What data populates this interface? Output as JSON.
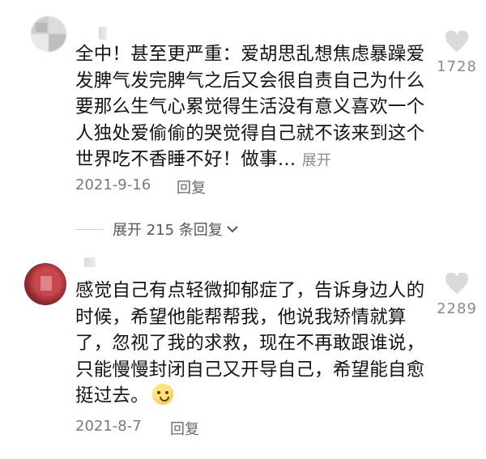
{
  "comments": [
    {
      "text": "全中！甚至更严重：爱胡思乱想焦虑暴躁爱发脾气发完脾气之后又会很自责自己为什么要那么生气心累觉得生活没有意义喜欢一个人独处爱偷偷的哭觉得自己就不该来到这个世界吃不香睡不好！做事…",
      "expand_label": "展开",
      "date": "2021-9-16",
      "reply_label": "回复",
      "like_count": "1728",
      "expand_replies_label": "展开 215 条回复"
    },
    {
      "text": "感觉自己有点轻微抑郁症了，告诉身边人的时候，希望他能帮帮我，他说我矫情就算了，忽视了我的求救，现在不再敢跟谁说，只能慢慢封闭自己又开导自己，希望能自愈挺过去。",
      "date": "2021-8-7",
      "reply_label": "回复",
      "like_count": "2289"
    }
  ],
  "icons": {
    "like": "heart-icon",
    "expand": "chevron-down-icon",
    "emoji": "pleading-face-emoji"
  },
  "colors": {
    "text": "#141414",
    "meta": "#7a7a7a",
    "heart": "#dadada"
  }
}
